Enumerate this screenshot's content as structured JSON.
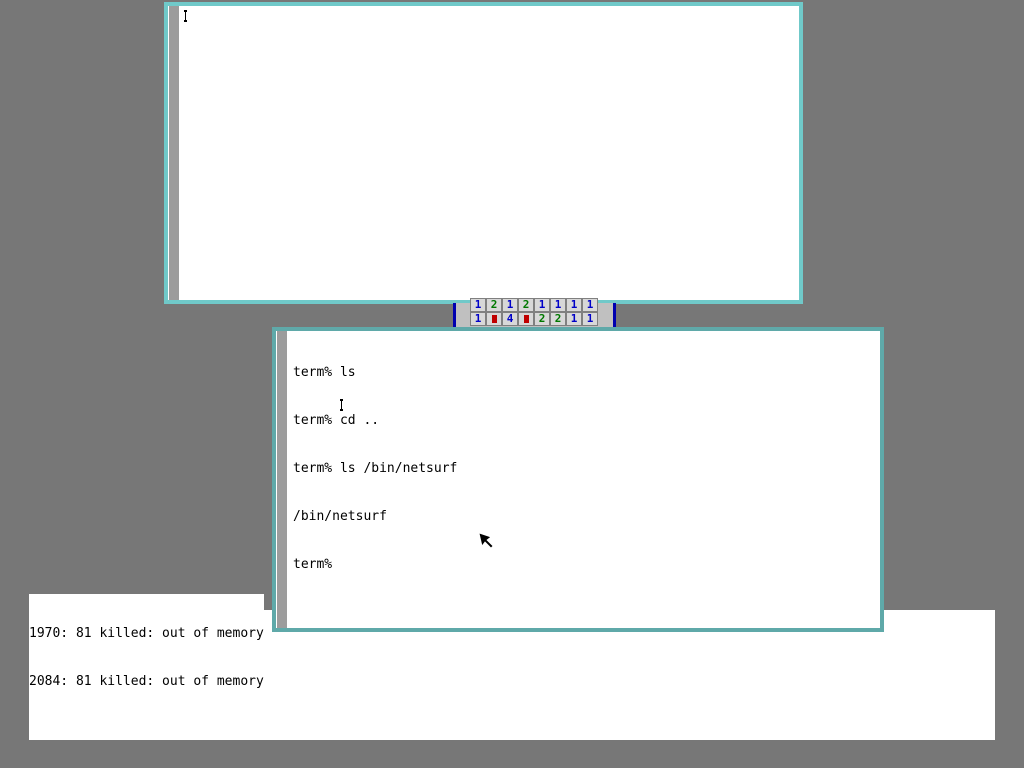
{
  "top_window": {
    "text": ""
  },
  "minesweeper": {
    "row1": [
      "1",
      "2",
      "1",
      "2",
      "1",
      "1",
      "1",
      "1"
    ],
    "row2": [
      "1",
      "flag",
      "4",
      "flag",
      "2",
      "2",
      "1",
      "1"
    ],
    "colors": {
      "blue": "#0000c8",
      "green": "#007800",
      "flag": "#c00000"
    }
  },
  "terminal": {
    "lines": [
      "term% ls",
      "term% cd ..",
      "term% ls /bin/netsurf",
      "/bin/netsurf",
      "term% "
    ]
  },
  "messages": [
    "1970: 81 killed: out of memory",
    "2084: 81 killed: out of memory"
  ],
  "colors": {
    "desktop": "#777777",
    "window_border": "#70c9c9",
    "scroll_thumb": "#9c9c9c"
  }
}
